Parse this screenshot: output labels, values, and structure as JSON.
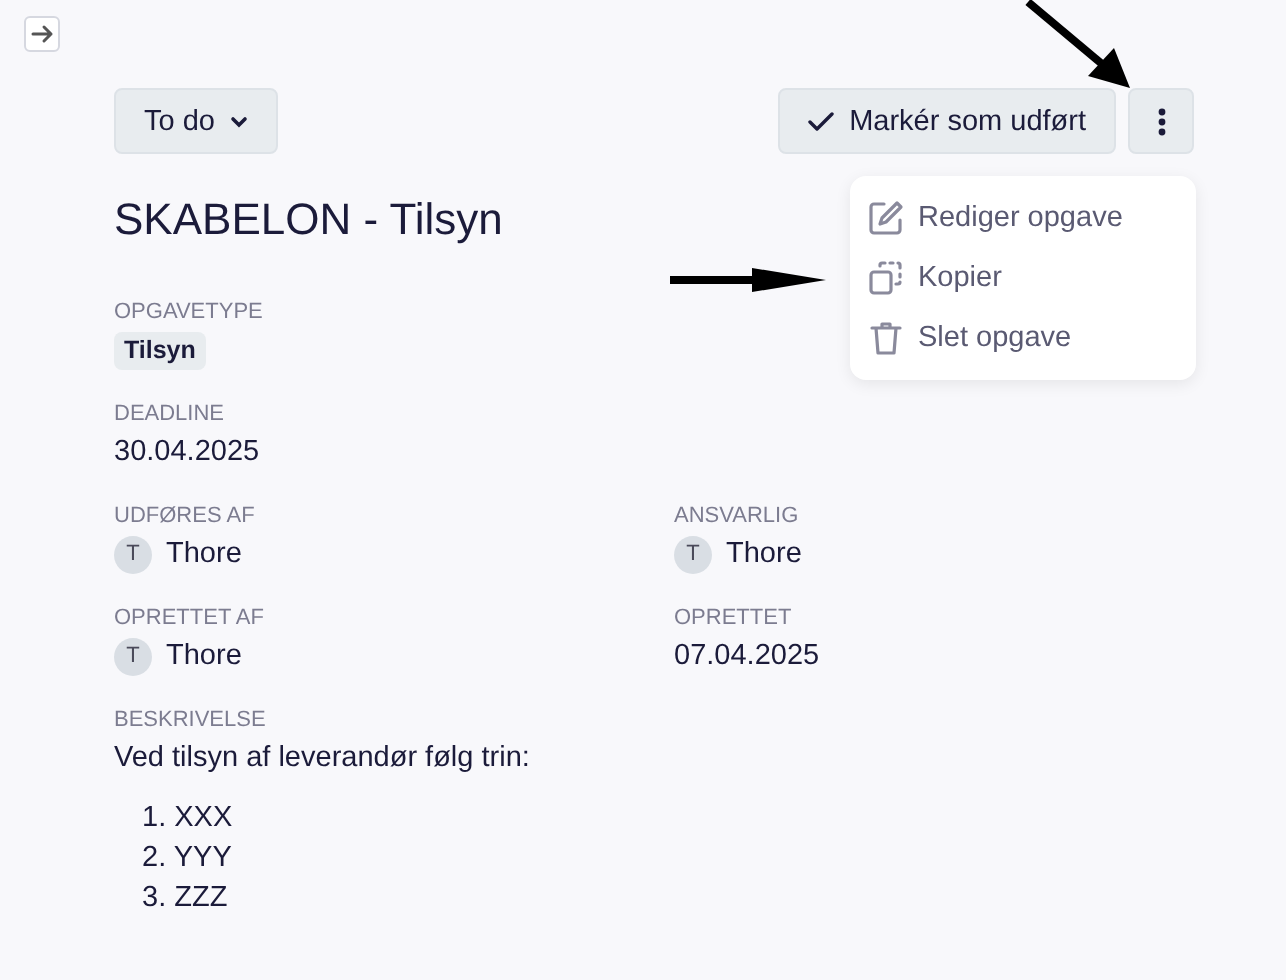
{
  "toolbar": {
    "status_dropdown": {
      "label": "To do"
    },
    "complete_button": {
      "label": "Markér som udført"
    }
  },
  "menu": [
    {
      "kind": "edit",
      "label": "Rediger opgave"
    },
    {
      "kind": "copy",
      "label": "Kopier"
    },
    {
      "kind": "delete",
      "label": "Slet opgave"
    }
  ],
  "title": "SKABELON - Tilsyn",
  "rows": [
    [
      {
        "label": "OPGAVETYPE",
        "kind": "tag",
        "value": "Tilsyn"
      }
    ],
    [
      {
        "label": "DEADLINE",
        "kind": "text",
        "value": "30.04.2025"
      }
    ],
    [
      {
        "label": "UDFØRES AF",
        "kind": "person",
        "initial": "T",
        "value": "Thore"
      },
      {
        "label": "ANSVARLIG",
        "kind": "person",
        "initial": "T",
        "value": "Thore"
      }
    ],
    [
      {
        "label": "OPRETTET AF",
        "kind": "person",
        "initial": "T",
        "value": "Thore"
      },
      {
        "label": "OPRETTET",
        "kind": "text",
        "value": "07.04.2025"
      }
    ]
  ],
  "description": {
    "label": "BESKRIVELSE",
    "text": "Ved tilsyn af leverandør følg trin:",
    "steps": [
      "1. XXX",
      "2. YYY",
      "3. ZZZ"
    ]
  }
}
